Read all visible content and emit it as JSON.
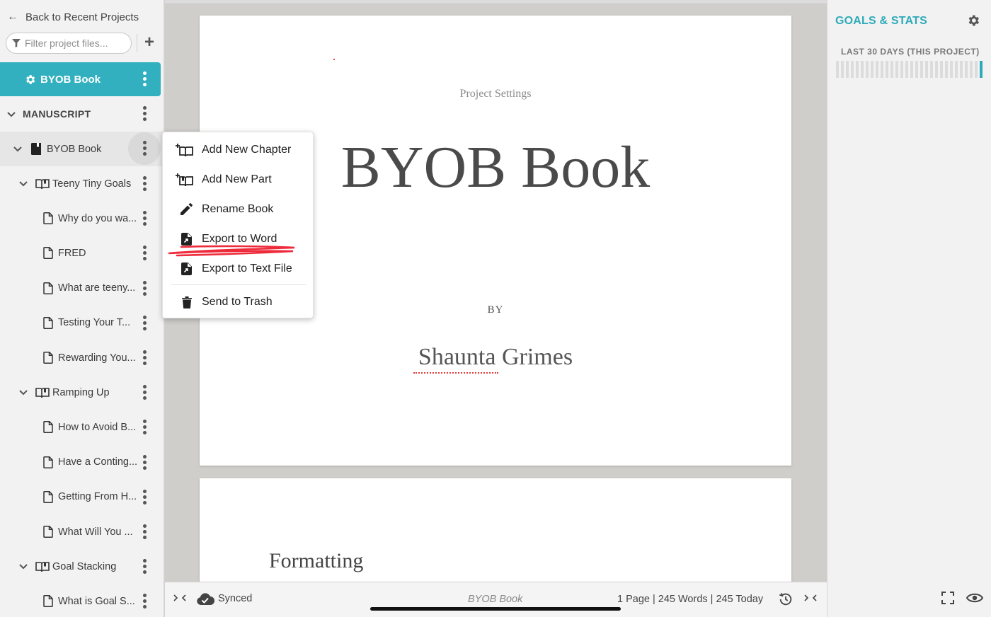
{
  "sidebar": {
    "back_label": "Back to Recent Projects",
    "filter_placeholder": "Filter project files...",
    "project_name": "BYOB Book",
    "section_label": "MANUSCRIPT",
    "book_label": "BYOB Book",
    "items": [
      {
        "label": "Teeny Tiny Goals",
        "type": "part"
      },
      {
        "label": "Why do you wa...",
        "type": "chapter"
      },
      {
        "label": "FRED",
        "type": "chapter"
      },
      {
        "label": "What are teeny...",
        "type": "chapter"
      },
      {
        "label": "Testing Your T...",
        "type": "chapter"
      },
      {
        "label": "Rewarding You...",
        "type": "chapter"
      },
      {
        "label": "Ramping Up",
        "type": "part"
      },
      {
        "label": "How to Avoid B...",
        "type": "chapter"
      },
      {
        "label": "Have a Conting...",
        "type": "chapter"
      },
      {
        "label": "Getting From H...",
        "type": "chapter"
      },
      {
        "label": "What Will You ...",
        "type": "chapter"
      },
      {
        "label": "Goal Stacking",
        "type": "part"
      },
      {
        "label": "What is Goal S...",
        "type": "chapter"
      }
    ]
  },
  "context_menu": {
    "items": [
      {
        "label": "Add New Chapter",
        "icon": "add-chapter-icon"
      },
      {
        "label": "Add New Part",
        "icon": "add-part-icon"
      },
      {
        "label": "Rename Book",
        "icon": "pencil-icon"
      },
      {
        "label": "Export to Word",
        "icon": "export-file-icon"
      },
      {
        "label": "Export to Text File",
        "icon": "export-file-icon"
      },
      {
        "label": "Send to Trash",
        "icon": "trash-icon"
      }
    ]
  },
  "editor": {
    "page1": {
      "header": "Project Settings",
      "title": "BYOB Book",
      "by": "BY",
      "author": "Shaunta Grimes"
    },
    "page2": {
      "heading": "Formatting"
    },
    "status": {
      "sync": "Synced",
      "doc_name": "BYOB Book",
      "stats": "1 Page | 245 Words | 245 Today"
    }
  },
  "right_panel": {
    "title": "GOALS & STATS",
    "period_label": "LAST 30 DAYS (THIS PROJECT)"
  },
  "colors": {
    "accent": "#33b0bf",
    "accent_text": "#2eaab9",
    "spell_underline": "#e23b3b"
  }
}
